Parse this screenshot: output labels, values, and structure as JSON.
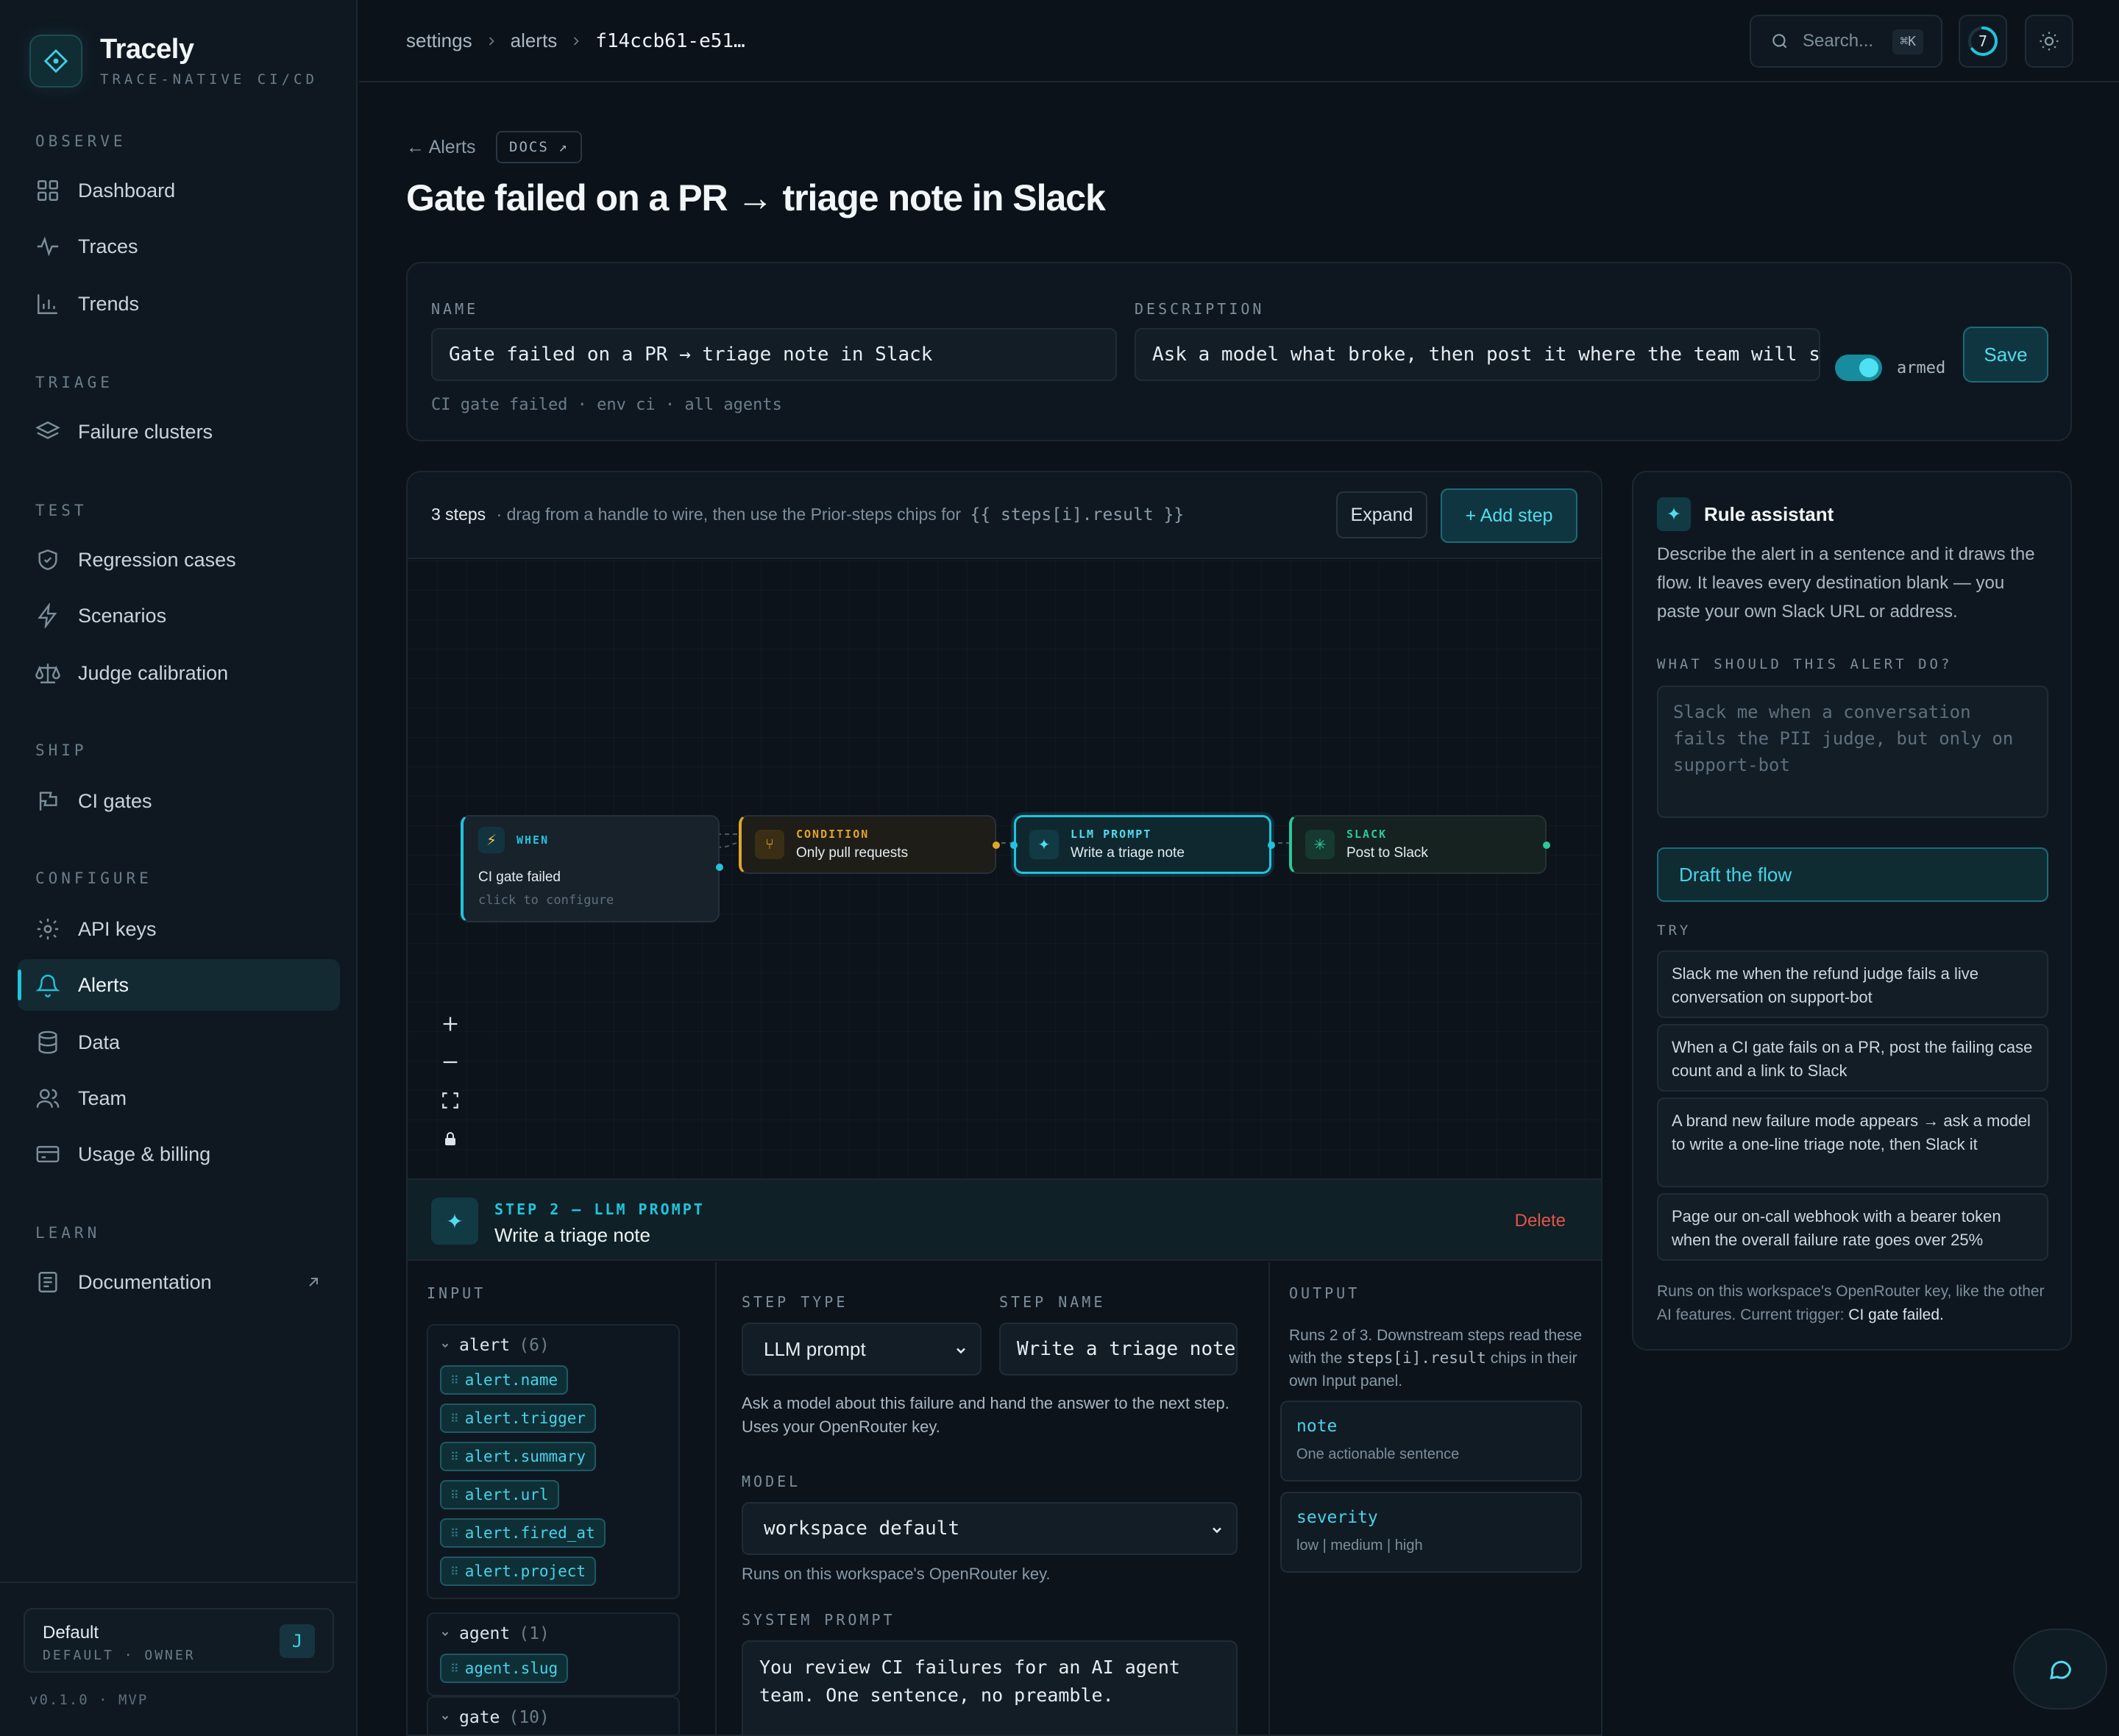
{
  "app": {
    "name": "Tracely",
    "tagline": "TRACE-NATIVE CI/CD",
    "accent": "#22c3dd"
  },
  "sidebar": {
    "sections": [
      {
        "label": "OBSERVE",
        "items": [
          {
            "label": "Dashboard",
            "icon": "grid-icon"
          },
          {
            "label": "Traces",
            "icon": "pulse-icon"
          },
          {
            "label": "Trends",
            "icon": "bar-chart-icon"
          }
        ]
      },
      {
        "label": "TRIAGE",
        "items": [
          {
            "label": "Failure clusters",
            "icon": "layers-icon"
          }
        ]
      },
      {
        "label": "TEST",
        "items": [
          {
            "label": "Regression cases",
            "icon": "shield-check-icon"
          },
          {
            "label": "Scenarios",
            "icon": "bolt-icon"
          },
          {
            "label": "Judge calibration",
            "icon": "scale-icon"
          }
        ]
      },
      {
        "label": "SHIP",
        "items": [
          {
            "label": "CI gates",
            "icon": "flag-icon"
          }
        ]
      },
      {
        "label": "CONFIGURE",
        "items": [
          {
            "label": "API keys",
            "icon": "gear-icon"
          },
          {
            "label": "Alerts",
            "icon": "bell-icon",
            "active": true
          },
          {
            "label": "Data",
            "icon": "database-icon"
          },
          {
            "label": "Team",
            "icon": "users-icon"
          },
          {
            "label": "Usage & billing",
            "icon": "credit-card-icon"
          }
        ]
      },
      {
        "label": "LEARN",
        "items": [
          {
            "label": "Documentation",
            "icon": "book-icon",
            "external": true
          }
        ]
      }
    ],
    "workspace": {
      "name": "Default",
      "role": "DEFAULT · OWNER",
      "avatar": "J"
    },
    "version": "v0.1.0 · MVP"
  },
  "topbar": {
    "breadcrumb": [
      "settings",
      "alerts",
      "f14ccb61-e51…"
    ],
    "search_placeholder": "Search...",
    "search_shortcut": "⌘K",
    "notification_count": "7"
  },
  "page": {
    "back_label": "← Alerts",
    "docs_label": "DOCS ↗",
    "title": "Gate failed on a PR → triage note in Slack"
  },
  "rule": {
    "name_label": "NAME",
    "name_value": "Gate failed on a PR → triage note in Slack",
    "description_label": "DESCRIPTION",
    "description_value": "Ask a model what broke, then post it where the team will see i",
    "meta": "CI gate failed · env ci · all agents",
    "armed_label": "armed",
    "armed": true,
    "save_label": "Save"
  },
  "flow": {
    "steps_count": "3 steps",
    "hint_prefix": "· drag from a handle to wire, then use the Prior-steps chips for",
    "hint_code": "{{ steps[i].result }}",
    "expand_label": "Expand",
    "add_step_label": "+ Add step",
    "nodes": [
      {
        "type": "WHEN",
        "name": "CI gate failed",
        "sub": "click to configure",
        "color": "#22c3dd"
      },
      {
        "type": "CONDITION",
        "name": "Only pull requests",
        "color": "#e0a52a"
      },
      {
        "type": "LLM PROMPT",
        "name": "Write a triage note",
        "color": "#22c3dd"
      },
      {
        "type": "SLACK",
        "name": "Post to Slack",
        "color": "#2bc99a"
      }
    ]
  },
  "step_detail": {
    "header": "STEP 2 — LLM PROMPT",
    "name": "Write a triage note",
    "delete_label": "Delete",
    "input_label": "INPUT",
    "groups": [
      {
        "name": "alert",
        "count": "(6)",
        "chips": [
          "alert.name",
          "alert.trigger",
          "alert.summary",
          "alert.url",
          "alert.fired_at",
          "alert.project"
        ]
      },
      {
        "name": "agent",
        "count": "(1)",
        "chips": [
          "agent.slug"
        ]
      },
      {
        "name": "gate",
        "count": "(10)",
        "chips": []
      }
    ],
    "step_type_label": "STEP TYPE",
    "step_type_value": "LLM prompt",
    "step_name_label": "STEP NAME",
    "step_name_value": "Write a triage note",
    "step_desc": "Ask a model about this failure and hand the answer to the next step. Uses your OpenRouter key.",
    "model_label": "MODEL",
    "model_value": "workspace default",
    "model_note": "Runs on this workspace's OpenRouter key.",
    "system_prompt_label": "SYSTEM PROMPT",
    "system_prompt_value": "You review CI failures for an AI agent team. One sentence, no preamble.",
    "output_label": "OUTPUT",
    "output_desc_1": "Runs 2 of 3. Downstream steps read these with the",
    "output_desc_code": "steps[i].result",
    "output_desc_2": "chips in their own Input panel.",
    "outputs": [
      {
        "key": "note",
        "desc": "One actionable sentence"
      },
      {
        "key": "severity",
        "desc": "low | medium | high"
      }
    ]
  },
  "assistant": {
    "title": "Rule assistant",
    "description": "Describe the alert in a sentence and it draws the flow. It leaves every destination blank — you paste your own Slack URL or address.",
    "prompt_label": "WHAT SHOULD THIS ALERT DO?",
    "prompt_placeholder": "Slack me when a conversation fails the PII judge, but only on support-bot",
    "draft_label": "Draft the flow",
    "try_label": "TRY",
    "suggestions": [
      "Slack me when the refund judge fails a live conversation on support-bot",
      "When a CI gate fails on a PR, post the failing case count and a link to Slack",
      "A brand new failure mode appears → ask a model to write a one-line triage note, then Slack it",
      "Page our on-call webhook with a bearer token when the overall failure rate goes over 25%"
    ],
    "footer_prefix": "Runs on this workspace's OpenRouter key, like the other AI features. Current trigger:",
    "footer_trigger": "CI gate failed."
  }
}
